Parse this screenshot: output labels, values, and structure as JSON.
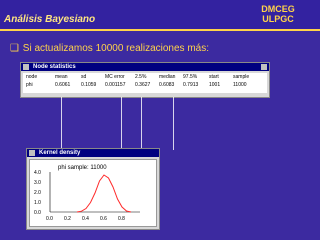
{
  "header": {
    "title": "Análisis Bayesiano",
    "brand_line1": "DMCEG",
    "brand_line2": "ULPGC"
  },
  "bullet": {
    "text": "Si actualizamos 10000 realizaciones más:"
  },
  "node_stats": {
    "title": "Node statistics",
    "columns": [
      "node",
      "mean",
      "sd",
      "MC error",
      "2.5%",
      "median",
      "97.5%",
      "start",
      "sample"
    ],
    "row": [
      "phi",
      "0.6061",
      "0.1059",
      "0.001157",
      "0.3627",
      "0.6083",
      "0.7913",
      "1001",
      "11000"
    ]
  },
  "kernel_density": {
    "title": "Kernel density",
    "plot_label": "phi sample: 11000",
    "y_ticks": [
      "4.0",
      "3.0",
      "2.0",
      "1.0",
      "0.0"
    ],
    "x_ticks": [
      "0.0",
      "0.2",
      "0.4",
      "0.6",
      "0.8"
    ]
  },
  "colors": {
    "background": "#3c2aa0",
    "accent": "#ffd34a",
    "window_title": "#000080"
  },
  "chart_data": {
    "type": "line",
    "title": "phi sample: 11000",
    "x": [
      0.3,
      0.35,
      0.4,
      0.45,
      0.5,
      0.55,
      0.6,
      0.65,
      0.7,
      0.75,
      0.8,
      0.85,
      0.9
    ],
    "y": [
      0.0,
      0.08,
      0.35,
      0.95,
      1.9,
      3.1,
      3.7,
      3.4,
      2.5,
      1.3,
      0.5,
      0.1,
      0.0
    ],
    "xlim": [
      0.0,
      1.0
    ],
    "ylim": [
      0.0,
      4.0
    ]
  }
}
